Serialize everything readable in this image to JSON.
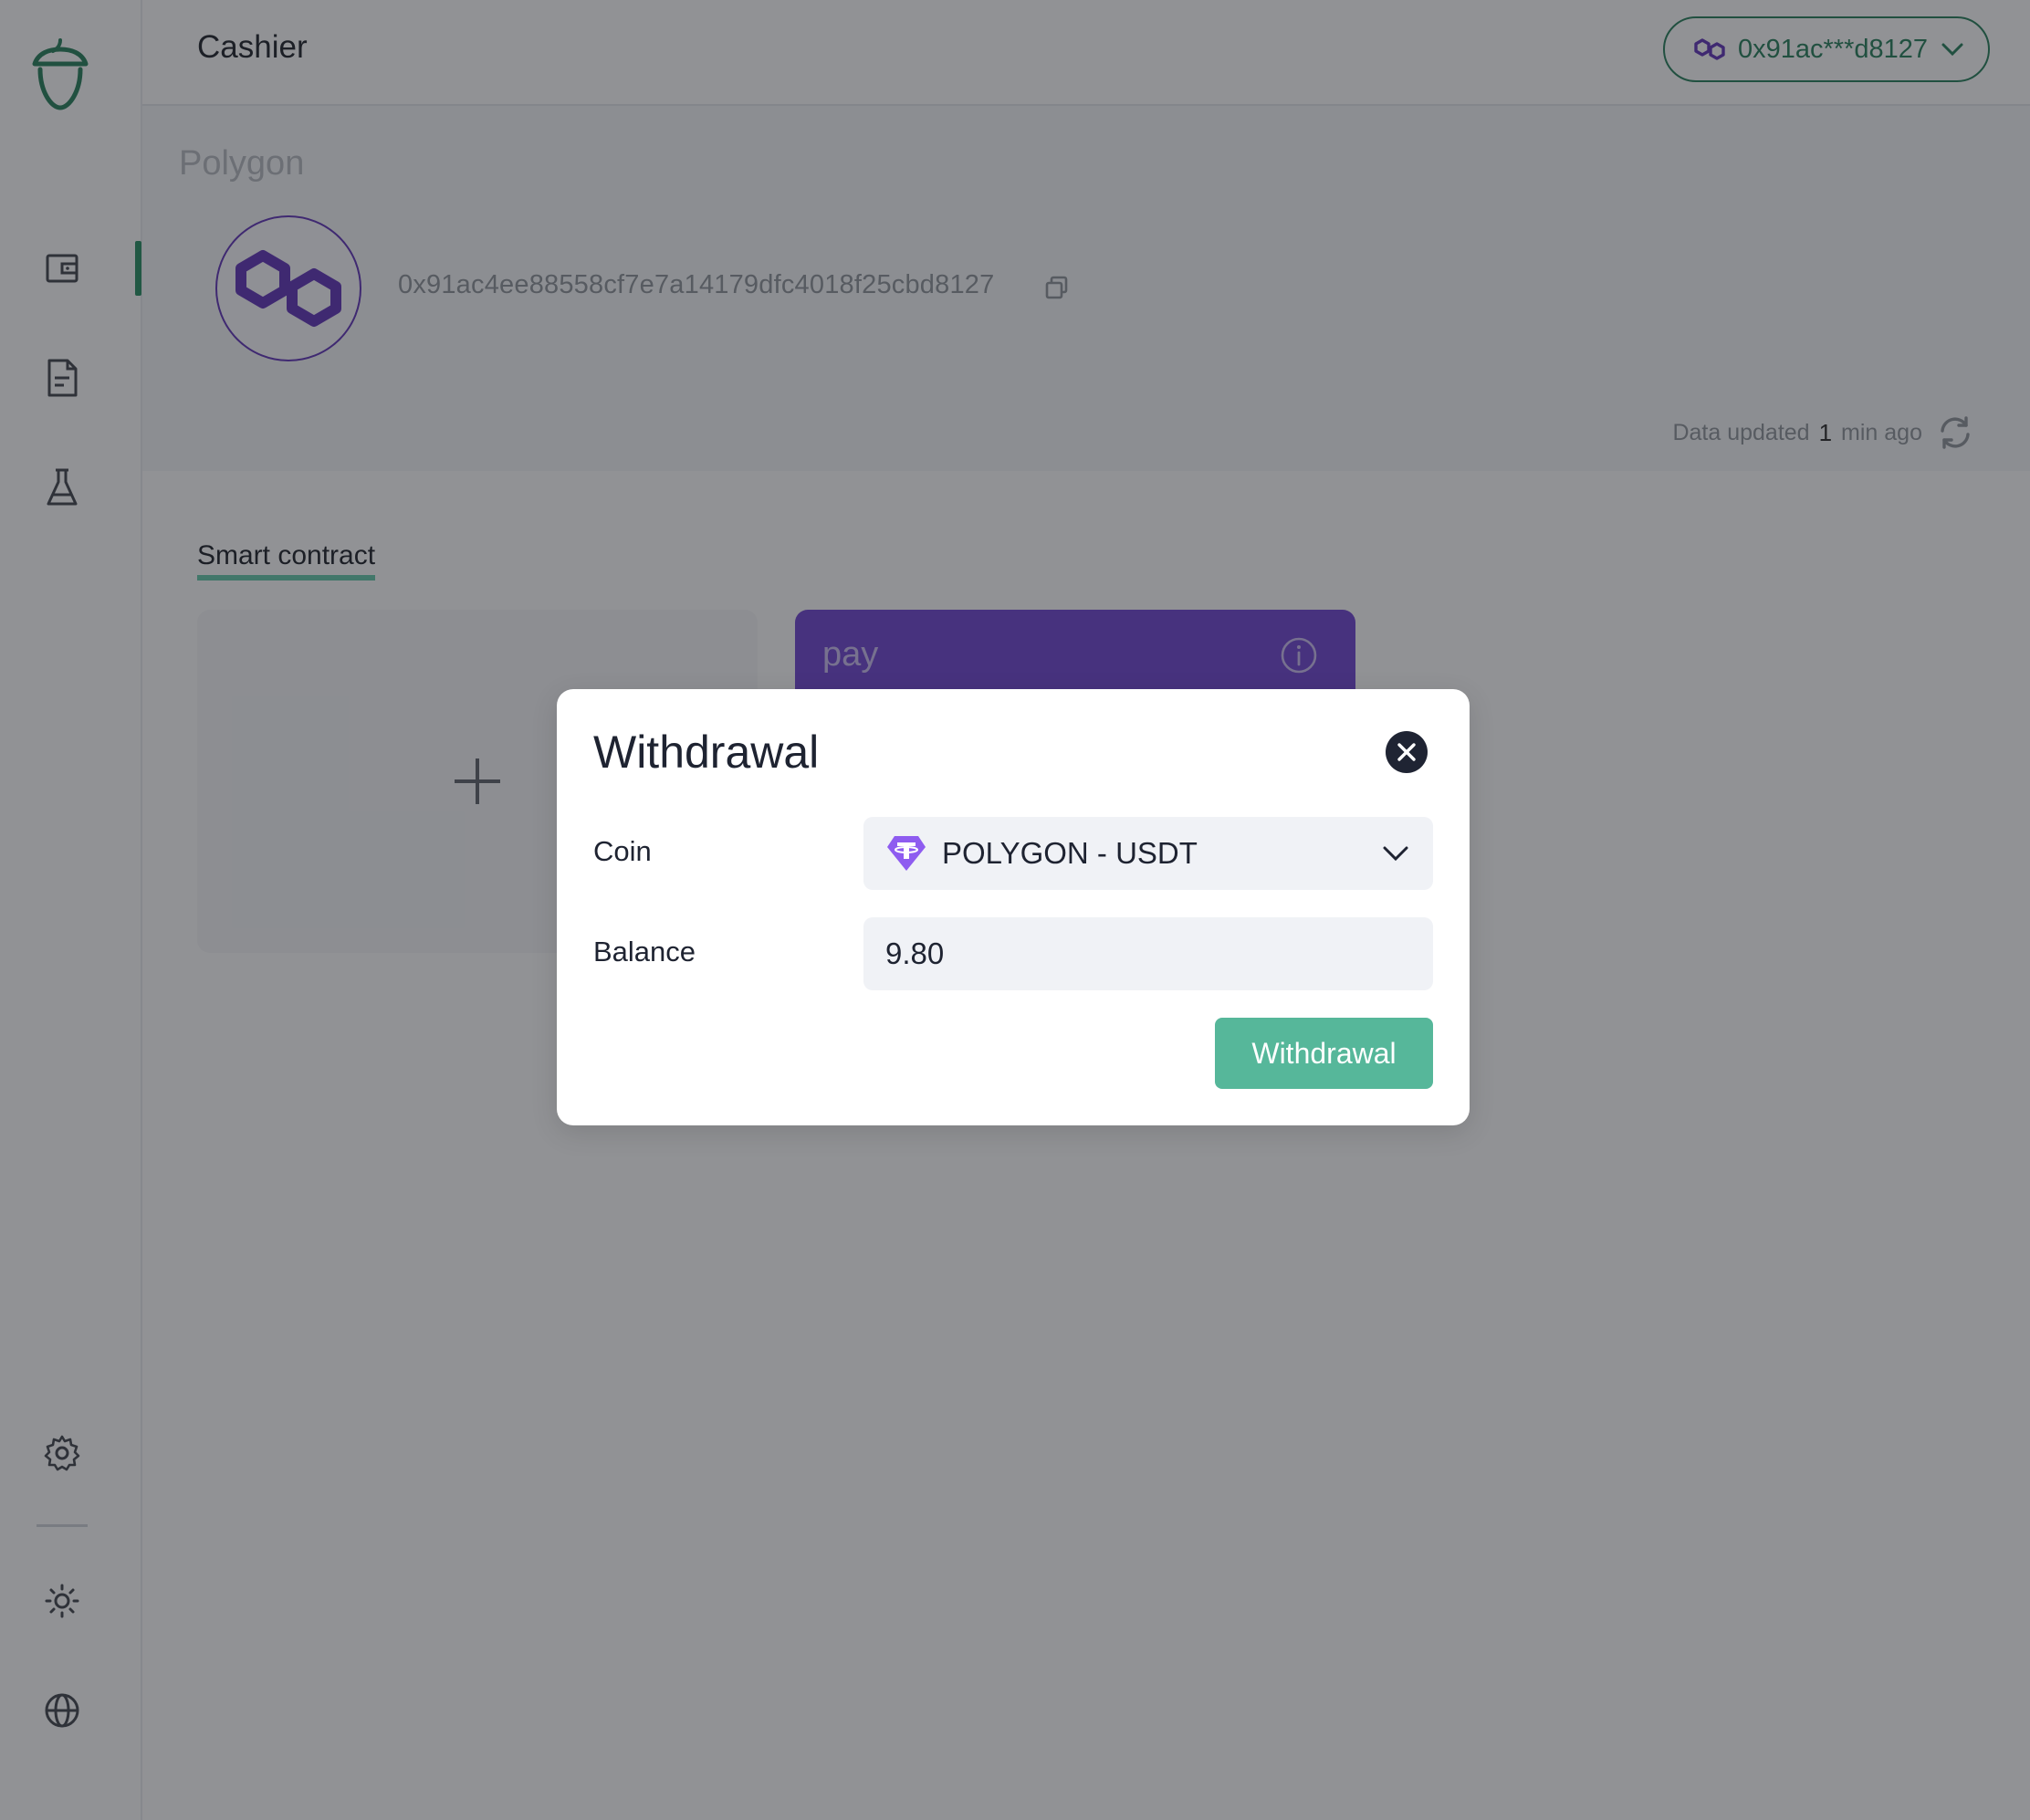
{
  "header": {
    "title": "Cashier",
    "wallet_short": "0x91ac***d8127"
  },
  "sidebar": {
    "items": [
      {
        "icon": "wallet-icon",
        "active": true
      },
      {
        "icon": "document-icon",
        "active": false
      },
      {
        "icon": "flask-icon",
        "active": false
      }
    ],
    "bottom_items": [
      {
        "icon": "gear-icon"
      },
      {
        "icon": "sun-icon"
      },
      {
        "icon": "globe-icon"
      }
    ]
  },
  "network": {
    "name": "Polygon",
    "address": "0x91ac4ee88558cf7e7a14179dfc4018f25cbd8127",
    "updated_prefix": "Data updated",
    "updated_value": "1",
    "updated_suffix": "min ago"
  },
  "contracts": {
    "tab_label": "Smart contract",
    "cards": [
      {
        "type": "add"
      },
      {
        "type": "contract",
        "title": "pay"
      }
    ]
  },
  "modal": {
    "title": "Withdrawal",
    "coin_label": "Coin",
    "coin_value": "POLYGON - USDT",
    "balance_label": "Balance",
    "balance_value": "9.80",
    "submit_label": "Withdrawal"
  },
  "colors": {
    "brand_green": "#1f7a55",
    "accent_purple": "#6a3fd0",
    "button_green": "#56b79a"
  }
}
